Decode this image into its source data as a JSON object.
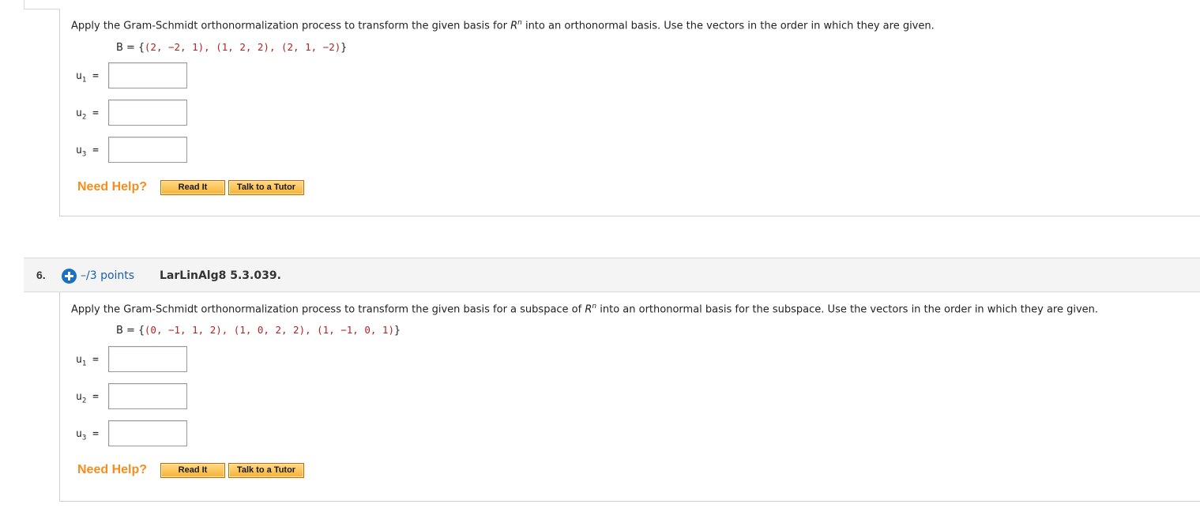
{
  "question5": {
    "prompt_before": "Apply the Gram-Schmidt orthonormalization process to transform the given basis for ",
    "prompt_R": "R",
    "prompt_sup": "n",
    "prompt_after": " into an orthonormal basis. Use the vectors in the order in which they are given.",
    "basis_label": "B = ",
    "basis_open": "{",
    "basis_set": "(2, −2, 1), (1, 2, 2), (2, 1, −2)",
    "basis_close": "}",
    "answers": [
      {
        "label": "u",
        "sub": "1",
        "eq": " =",
        "value": ""
      },
      {
        "label": "u",
        "sub": "2",
        "eq": " =",
        "value": ""
      },
      {
        "label": "u",
        "sub": "3",
        "eq": " =",
        "value": ""
      }
    ],
    "help": {
      "label": "Need Help?",
      "read_it": "Read It",
      "tutor": "Talk to a Tutor"
    }
  },
  "question6": {
    "number": "6.",
    "points": "–/3 points",
    "source": "LarLinAlg8 5.3.039.",
    "prompt_before": "Apply the Gram-Schmidt orthonormalization process to transform the given basis for a subspace of ",
    "prompt_R": "R",
    "prompt_sup": "n",
    "prompt_after": " into an orthonormal basis for the subspace. Use the vectors in the order in which they are given.",
    "basis_label": "B = ",
    "basis_open": "{",
    "basis_set": "(0, −1, 1, 2), (1, 0, 2, 2), (1, −1, 0, 1)",
    "basis_close": "}",
    "answers": [
      {
        "label": "u",
        "sub": "1",
        "eq": " =",
        "value": ""
      },
      {
        "label": "u",
        "sub": "2",
        "eq": " =",
        "value": ""
      },
      {
        "label": "u",
        "sub": "3",
        "eq": " =",
        "value": ""
      }
    ],
    "help": {
      "label": "Need Help?",
      "read_it": "Read It",
      "tutor": "Talk to a Tutor"
    }
  },
  "colors": {
    "accent_orange": "#f58d1f",
    "basis_red": "#b22222",
    "points_blue": "#1b5fa8",
    "plus_blue": "#1b6fc4"
  },
  "icons": {
    "add": "plus-circle-icon"
  }
}
